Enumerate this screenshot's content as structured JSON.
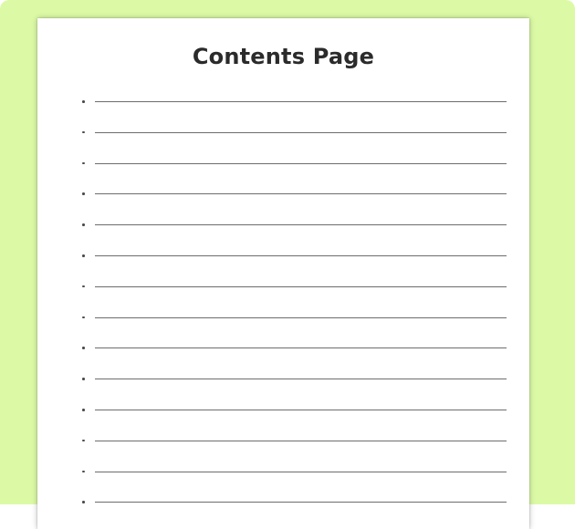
{
  "page": {
    "title": "Contents Page",
    "background_color": "#dcfaa6",
    "sheet_color": "#ffffff",
    "line_color": "#6d6d6d",
    "entry_count": 14,
    "entry_shape": "bullet-dot",
    "entries": [
      "",
      "",
      "",
      "",
      "",
      "",
      "",
      "",
      "",
      "",
      "",
      "",
      "",
      ""
    ]
  }
}
